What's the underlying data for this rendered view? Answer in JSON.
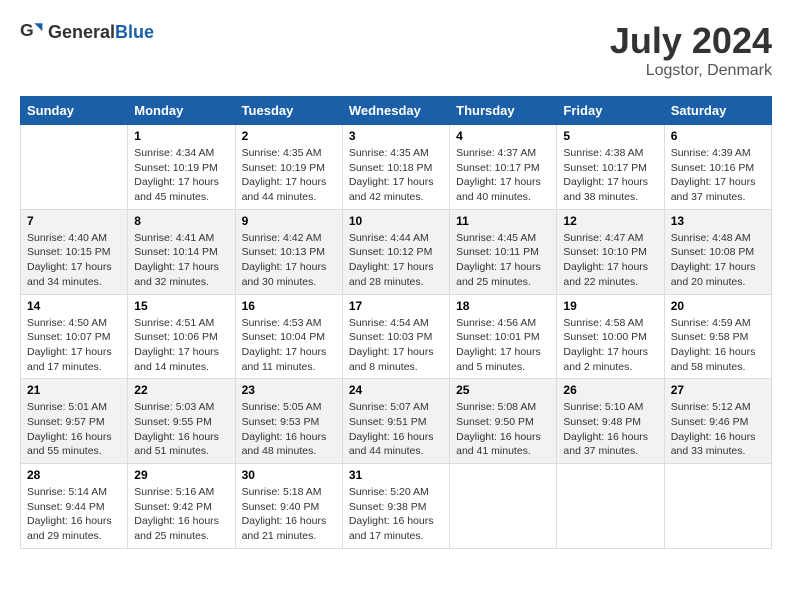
{
  "header": {
    "logo_general": "General",
    "logo_blue": "Blue",
    "month_year": "July 2024",
    "location": "Logstor, Denmark"
  },
  "days_of_week": [
    "Sunday",
    "Monday",
    "Tuesday",
    "Wednesday",
    "Thursday",
    "Friday",
    "Saturday"
  ],
  "weeks": [
    [
      {
        "day": "",
        "info": ""
      },
      {
        "day": "1",
        "info": "Sunrise: 4:34 AM\nSunset: 10:19 PM\nDaylight: 17 hours\nand 45 minutes."
      },
      {
        "day": "2",
        "info": "Sunrise: 4:35 AM\nSunset: 10:19 PM\nDaylight: 17 hours\nand 44 minutes."
      },
      {
        "day": "3",
        "info": "Sunrise: 4:35 AM\nSunset: 10:18 PM\nDaylight: 17 hours\nand 42 minutes."
      },
      {
        "day": "4",
        "info": "Sunrise: 4:37 AM\nSunset: 10:17 PM\nDaylight: 17 hours\nand 40 minutes."
      },
      {
        "day": "5",
        "info": "Sunrise: 4:38 AM\nSunset: 10:17 PM\nDaylight: 17 hours\nand 38 minutes."
      },
      {
        "day": "6",
        "info": "Sunrise: 4:39 AM\nSunset: 10:16 PM\nDaylight: 17 hours\nand 37 minutes."
      }
    ],
    [
      {
        "day": "7",
        "info": "Sunrise: 4:40 AM\nSunset: 10:15 PM\nDaylight: 17 hours\nand 34 minutes."
      },
      {
        "day": "8",
        "info": "Sunrise: 4:41 AM\nSunset: 10:14 PM\nDaylight: 17 hours\nand 32 minutes."
      },
      {
        "day": "9",
        "info": "Sunrise: 4:42 AM\nSunset: 10:13 PM\nDaylight: 17 hours\nand 30 minutes."
      },
      {
        "day": "10",
        "info": "Sunrise: 4:44 AM\nSunset: 10:12 PM\nDaylight: 17 hours\nand 28 minutes."
      },
      {
        "day": "11",
        "info": "Sunrise: 4:45 AM\nSunset: 10:11 PM\nDaylight: 17 hours\nand 25 minutes."
      },
      {
        "day": "12",
        "info": "Sunrise: 4:47 AM\nSunset: 10:10 PM\nDaylight: 17 hours\nand 22 minutes."
      },
      {
        "day": "13",
        "info": "Sunrise: 4:48 AM\nSunset: 10:08 PM\nDaylight: 17 hours\nand 20 minutes."
      }
    ],
    [
      {
        "day": "14",
        "info": "Sunrise: 4:50 AM\nSunset: 10:07 PM\nDaylight: 17 hours\nand 17 minutes."
      },
      {
        "day": "15",
        "info": "Sunrise: 4:51 AM\nSunset: 10:06 PM\nDaylight: 17 hours\nand 14 minutes."
      },
      {
        "day": "16",
        "info": "Sunrise: 4:53 AM\nSunset: 10:04 PM\nDaylight: 17 hours\nand 11 minutes."
      },
      {
        "day": "17",
        "info": "Sunrise: 4:54 AM\nSunset: 10:03 PM\nDaylight: 17 hours\nand 8 minutes."
      },
      {
        "day": "18",
        "info": "Sunrise: 4:56 AM\nSunset: 10:01 PM\nDaylight: 17 hours\nand 5 minutes."
      },
      {
        "day": "19",
        "info": "Sunrise: 4:58 AM\nSunset: 10:00 PM\nDaylight: 17 hours\nand 2 minutes."
      },
      {
        "day": "20",
        "info": "Sunrise: 4:59 AM\nSunset: 9:58 PM\nDaylight: 16 hours\nand 58 minutes."
      }
    ],
    [
      {
        "day": "21",
        "info": "Sunrise: 5:01 AM\nSunset: 9:57 PM\nDaylight: 16 hours\nand 55 minutes."
      },
      {
        "day": "22",
        "info": "Sunrise: 5:03 AM\nSunset: 9:55 PM\nDaylight: 16 hours\nand 51 minutes."
      },
      {
        "day": "23",
        "info": "Sunrise: 5:05 AM\nSunset: 9:53 PM\nDaylight: 16 hours\nand 48 minutes."
      },
      {
        "day": "24",
        "info": "Sunrise: 5:07 AM\nSunset: 9:51 PM\nDaylight: 16 hours\nand 44 minutes."
      },
      {
        "day": "25",
        "info": "Sunrise: 5:08 AM\nSunset: 9:50 PM\nDaylight: 16 hours\nand 41 minutes."
      },
      {
        "day": "26",
        "info": "Sunrise: 5:10 AM\nSunset: 9:48 PM\nDaylight: 16 hours\nand 37 minutes."
      },
      {
        "day": "27",
        "info": "Sunrise: 5:12 AM\nSunset: 9:46 PM\nDaylight: 16 hours\nand 33 minutes."
      }
    ],
    [
      {
        "day": "28",
        "info": "Sunrise: 5:14 AM\nSunset: 9:44 PM\nDaylight: 16 hours\nand 29 minutes."
      },
      {
        "day": "29",
        "info": "Sunrise: 5:16 AM\nSunset: 9:42 PM\nDaylight: 16 hours\nand 25 minutes."
      },
      {
        "day": "30",
        "info": "Sunrise: 5:18 AM\nSunset: 9:40 PM\nDaylight: 16 hours\nand 21 minutes."
      },
      {
        "day": "31",
        "info": "Sunrise: 5:20 AM\nSunset: 9:38 PM\nDaylight: 16 hours\nand 17 minutes."
      },
      {
        "day": "",
        "info": ""
      },
      {
        "day": "",
        "info": ""
      },
      {
        "day": "",
        "info": ""
      }
    ]
  ]
}
